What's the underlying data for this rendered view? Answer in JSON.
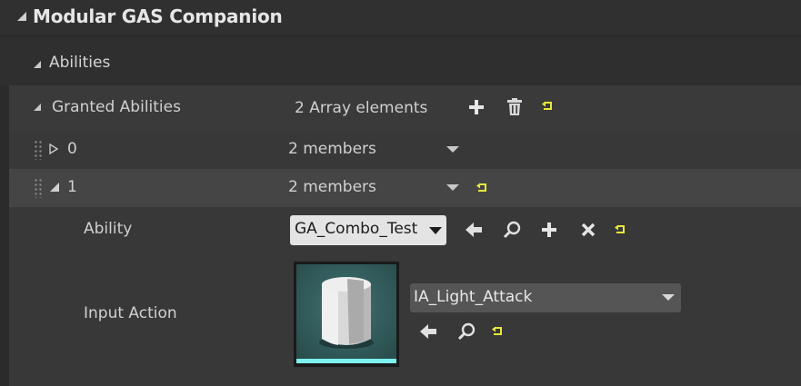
{
  "category": {
    "title": "Modular GAS Companion"
  },
  "subcategory": {
    "title": "Abilities"
  },
  "granted_abilities": {
    "label": "Granted Abilities",
    "value": "2 Array elements"
  },
  "elements": [
    {
      "index": "0",
      "summary": "2 members",
      "expanded": false
    },
    {
      "index": "1",
      "summary": "2 members",
      "expanded": true
    }
  ],
  "ability": {
    "label": "Ability",
    "selected": "GA_Combo_Test"
  },
  "input_action": {
    "label": "Input Action",
    "selected": "IA_Light_Attack"
  },
  "icons": {
    "add": "plus-icon",
    "delete": "trash-icon",
    "reset": "reset-to-default-icon",
    "browse_back": "left-arrow-icon",
    "find": "magnifier-icon",
    "clear": "x-icon"
  },
  "colors": {
    "reset_icon": "#e8e83a",
    "thumb_bar": "#7ff0f0"
  }
}
